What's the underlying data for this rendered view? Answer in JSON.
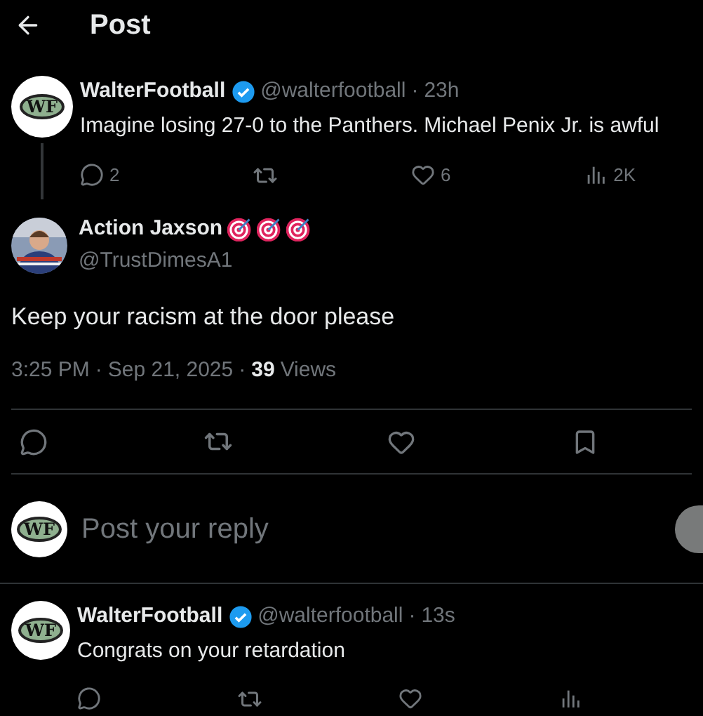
{
  "header": {
    "title": "Post"
  },
  "parent_post": {
    "avatar_text": "WF",
    "name": "WalterFootball",
    "verified": true,
    "handle": "@walterfootball",
    "separator": "·",
    "time": "23h",
    "text": "Imagine losing 27-0 to the Panthers. Michael Penix Jr. is awful",
    "stats": {
      "replies": "2",
      "likes": "6",
      "views": "2K"
    }
  },
  "main_post": {
    "name": "Action Jaxson",
    "handle": "@TrustDimesA1",
    "text": "Keep your racism at the door please",
    "time": "3:25 PM",
    "separator_1": "·",
    "date": "Sep 21, 2025",
    "separator_2": "·",
    "views_count": "39",
    "views_label": "Views"
  },
  "reply_box": {
    "avatar_text": "WF",
    "placeholder": "Post your reply"
  },
  "reply": {
    "avatar_text": "WF",
    "name": "WalterFootball",
    "verified": true,
    "handle": "@walterfootball",
    "separator": "·",
    "time": "13s",
    "text": "Congrats on your retardation"
  }
}
